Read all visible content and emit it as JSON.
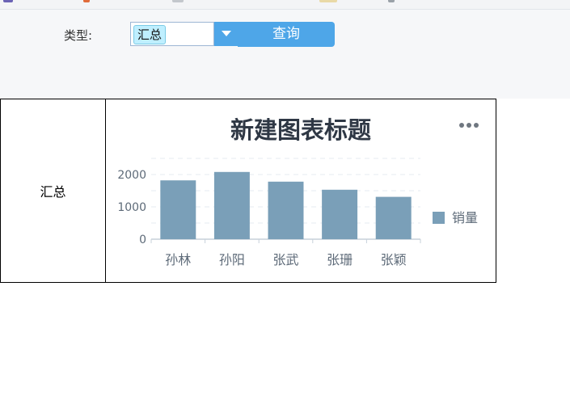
{
  "filter": {
    "type_label": "类型:",
    "selected_value": "汇总",
    "query_button": "查询"
  },
  "table": {
    "row_label": "汇总"
  },
  "chart_data": {
    "type": "bar",
    "title": "新建图表标题",
    "categories": [
      "孙林",
      "孙阳",
      "张武",
      "张珊",
      "张颖"
    ],
    "series": [
      {
        "name": "销量",
        "values": [
          1820,
          2080,
          1780,
          1530,
          1310
        ]
      }
    ],
    "ylim": [
      0,
      2500
    ],
    "yticks": [
      0,
      1000,
      2000
    ],
    "grid": true,
    "legend_position": "right",
    "bar_color": "#7a9fb8",
    "title_color": "#2f3845"
  }
}
